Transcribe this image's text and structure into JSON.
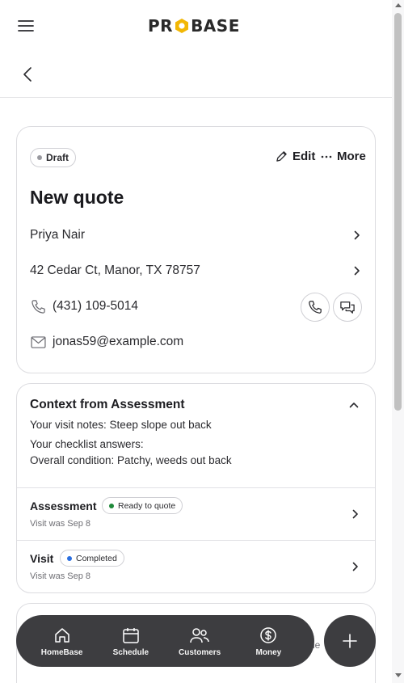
{
  "app": {
    "logo_text": "PROBASE",
    "logo_parts": {
      "left": "PR",
      "right": "BASE"
    },
    "brand_color": "#f2b705"
  },
  "quote": {
    "status": "Draft",
    "edit_label": "Edit",
    "more_label": "More",
    "title": "New quote",
    "customer_name": "Priya Nair",
    "address": "42 Cedar Ct, Manor, TX 78757",
    "phone": "(431) 109-5014",
    "email": "jonas59@example.com"
  },
  "context": {
    "title": "Context from Assessment",
    "visit_notes": "Your visit notes: Steep slope out back",
    "checklist_label": "Your checklist answers:",
    "checklist_answer": "Overall condition: Patchy, weeds out back",
    "items": [
      {
        "title": "Assessment",
        "badge": "Ready to quote",
        "badge_color": "#1f8a3a",
        "subtitle": "Visit was Sep 8"
      },
      {
        "title": "Visit",
        "badge": "Completed",
        "badge_color": "#2b6fe0",
        "subtitle": "Visit was Sep 8"
      }
    ]
  },
  "peek_text": "ne",
  "nav": {
    "items": [
      {
        "label": "HomeBase",
        "icon": "home-icon"
      },
      {
        "label": "Schedule",
        "icon": "calendar-icon"
      },
      {
        "label": "Customers",
        "icon": "people-icon"
      },
      {
        "label": "Money",
        "icon": "dollar-icon"
      }
    ],
    "fab_icon": "plus-icon"
  }
}
